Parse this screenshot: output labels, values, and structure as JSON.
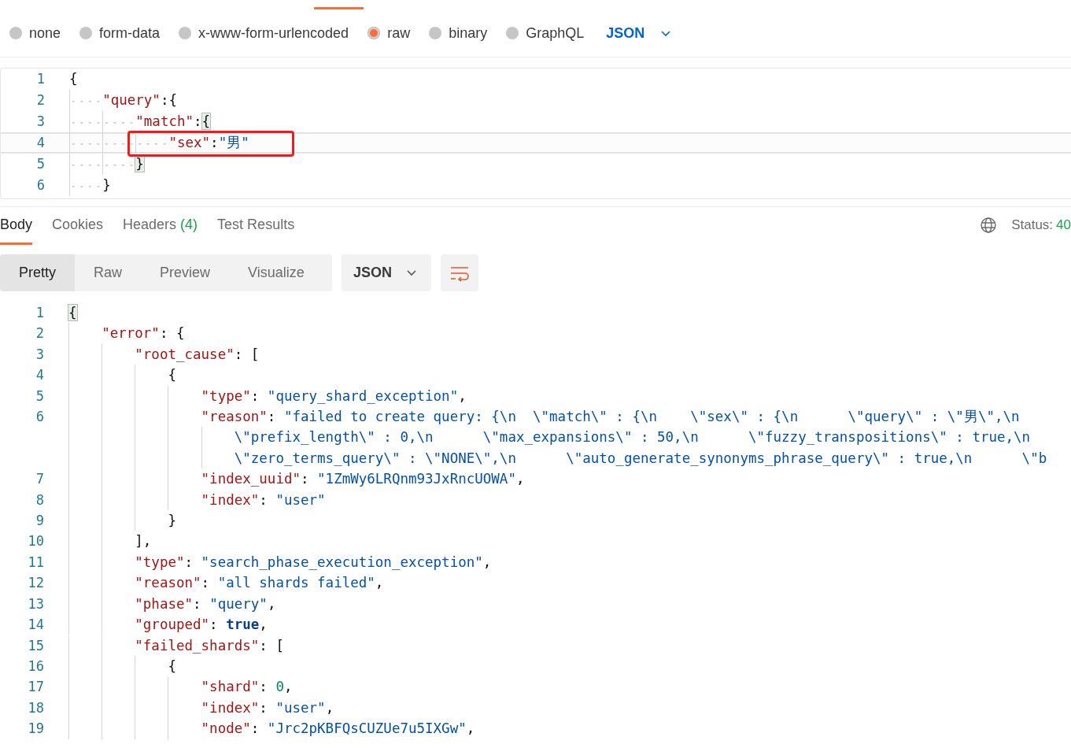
{
  "body_types": [
    {
      "label": "none",
      "selected": false
    },
    {
      "label": "form-data",
      "selected": false
    },
    {
      "label": "x-www-form-urlencoded",
      "selected": false
    },
    {
      "label": "raw",
      "selected": true
    },
    {
      "label": "binary",
      "selected": false
    },
    {
      "label": "GraphQL",
      "selected": false
    }
  ],
  "body_format": "JSON",
  "request_editor": {
    "show_whitespace": true,
    "lines": [
      {
        "number": "1",
        "active": false,
        "kind": "level0",
        "tokens": [
          {
            "t": "{",
            "kind": "punc"
          }
        ]
      },
      {
        "number": "2",
        "active": false,
        "kind": "level1",
        "tokens": [
          {
            "t": "\"query\"",
            "kind": "key"
          },
          {
            "t": ":",
            "kind": "punc"
          },
          {
            "t": "{",
            "kind": "punc"
          }
        ]
      },
      {
        "number": "3",
        "active": false,
        "kind": "level2",
        "tokens": [
          {
            "t": "\"match\"",
            "kind": "key"
          },
          {
            "t": ":",
            "kind": "punc"
          },
          {
            "t": "{",
            "kind": "brace-match"
          }
        ]
      },
      {
        "number": "4",
        "active": true,
        "kind": "level3",
        "tokens": [
          {
            "t": "\"sex\"",
            "kind": "key"
          },
          {
            "t": ":",
            "kind": "punc"
          },
          {
            "t": "\"男\"",
            "kind": "str"
          }
        ]
      },
      {
        "number": "5",
        "active": false,
        "kind": "level2",
        "tokens": [
          {
            "t": "}",
            "kind": "brace-match"
          }
        ]
      },
      {
        "number": "6",
        "active": false,
        "kind": "level1",
        "tokens": [
          {
            "t": "}",
            "kind": "punc"
          }
        ]
      }
    ]
  },
  "annotation": {
    "kind": "box"
  },
  "response": {
    "tabs": [
      {
        "label": "Body",
        "selected": true
      },
      {
        "label": "Cookies",
        "selected": false
      },
      {
        "label": "Headers",
        "count": "(4)",
        "selected": false
      },
      {
        "label": "Test Results",
        "selected": false
      }
    ],
    "status": {
      "label": "Status:",
      "value": "40"
    },
    "view_modes": [
      {
        "label": "Pretty",
        "selected": true
      },
      {
        "label": "Raw",
        "selected": false
      },
      {
        "label": "Preview",
        "selected": false
      },
      {
        "label": "Visualize",
        "selected": false
      }
    ],
    "format": "JSON",
    "editor": {
      "show_whitespace": false,
      "lines": [
        {
          "number": "1",
          "rows": [
            {
              "kind": "level0",
              "tokens": [
                {
                  "t": "{",
                  "kind": "brace-match"
                }
              ]
            }
          ]
        },
        {
          "number": "2",
          "rows": [
            {
              "kind": "level1",
              "tokens": [
                {
                  "t": "\"error\"",
                  "kind": "key"
                },
                {
                  "t": ": {",
                  "kind": "punc"
                }
              ]
            }
          ]
        },
        {
          "number": "3",
          "rows": [
            {
              "kind": "level2",
              "tokens": [
                {
                  "t": "\"root_cause\"",
                  "kind": "key"
                },
                {
                  "t": ": [",
                  "kind": "punc"
                }
              ]
            }
          ]
        },
        {
          "number": "4",
          "rows": [
            {
              "kind": "level3",
              "tokens": [
                {
                  "t": "{",
                  "kind": "punc"
                }
              ]
            }
          ]
        },
        {
          "number": "5",
          "rows": [
            {
              "kind": "level4",
              "tokens": [
                {
                  "t": "\"type\"",
                  "kind": "key"
                },
                {
                  "t": ": ",
                  "kind": "punc"
                },
                {
                  "t": "\"query_shard_exception\"",
                  "kind": "str"
                },
                {
                  "t": ",",
                  "kind": "punc"
                }
              ]
            }
          ]
        },
        {
          "number": "6",
          "rows": [
            {
              "kind": "level4",
              "tokens": [
                {
                  "t": "\"reason\"",
                  "kind": "key"
                },
                {
                  "t": ": ",
                  "kind": "punc"
                },
                {
                  "t": "\"failed to create query: {\\n  \\\"match\\\" : {\\n    \\\"sex\\\" : {\\n      \\\"query\\\" : \\\"男\\\",\\n",
                  "kind": "str"
                }
              ]
            },
            {
              "kind": "wrap",
              "tokens": [
                {
                  "t": "\\\"prefix_length\\\" : 0,\\n      \\\"max_expansions\\\" : 50,\\n      \\\"fuzzy_transpositions\\\" : true,\\n",
                  "kind": "str"
                }
              ]
            },
            {
              "kind": "wrap",
              "tokens": [
                {
                  "t": "\\\"zero_terms_query\\\" : \\\"NONE\\\",\\n      \\\"auto_generate_synonyms_phrase_query\\\" : true,\\n      \\\"b",
                  "kind": "str"
                }
              ]
            }
          ]
        },
        {
          "number": "7",
          "rows": [
            {
              "kind": "level4",
              "tokens": [
                {
                  "t": "\"index_uuid\"",
                  "kind": "key"
                },
                {
                  "t": ": ",
                  "kind": "punc"
                },
                {
                  "t": "\"1ZmWy6LRQnm93JxRncUOWA\"",
                  "kind": "str"
                },
                {
                  "t": ",",
                  "kind": "punc"
                }
              ]
            }
          ]
        },
        {
          "number": "8",
          "rows": [
            {
              "kind": "level4",
              "tokens": [
                {
                  "t": "\"index\"",
                  "kind": "key"
                },
                {
                  "t": ": ",
                  "kind": "punc"
                },
                {
                  "t": "\"user\"",
                  "kind": "str"
                }
              ]
            }
          ]
        },
        {
          "number": "9",
          "rows": [
            {
              "kind": "level3",
              "tokens": [
                {
                  "t": "}",
                  "kind": "punc"
                }
              ]
            }
          ]
        },
        {
          "number": "10",
          "rows": [
            {
              "kind": "level2",
              "tokens": [
                {
                  "t": "],",
                  "kind": "punc"
                }
              ]
            }
          ]
        },
        {
          "number": "11",
          "rows": [
            {
              "kind": "level2",
              "tokens": [
                {
                  "t": "\"type\"",
                  "kind": "key"
                },
                {
                  "t": ": ",
                  "kind": "punc"
                },
                {
                  "t": "\"search_phase_execution_exception\"",
                  "kind": "str"
                },
                {
                  "t": ",",
                  "kind": "punc"
                }
              ]
            }
          ]
        },
        {
          "number": "12",
          "rows": [
            {
              "kind": "level2",
              "tokens": [
                {
                  "t": "\"reason\"",
                  "kind": "key"
                },
                {
                  "t": ": ",
                  "kind": "punc"
                },
                {
                  "t": "\"all shards failed\"",
                  "kind": "str"
                },
                {
                  "t": ",",
                  "kind": "punc"
                }
              ]
            }
          ]
        },
        {
          "number": "13",
          "rows": [
            {
              "kind": "level2",
              "tokens": [
                {
                  "t": "\"phase\"",
                  "kind": "key"
                },
                {
                  "t": ": ",
                  "kind": "punc"
                },
                {
                  "t": "\"query\"",
                  "kind": "str"
                },
                {
                  "t": ",",
                  "kind": "punc"
                }
              ]
            }
          ]
        },
        {
          "number": "14",
          "rows": [
            {
              "kind": "level2",
              "tokens": [
                {
                  "t": "\"grouped\"",
                  "kind": "key"
                },
                {
                  "t": ": ",
                  "kind": "punc"
                },
                {
                  "t": "true",
                  "kind": "bool"
                },
                {
                  "t": ",",
                  "kind": "punc"
                }
              ]
            }
          ]
        },
        {
          "number": "15",
          "rows": [
            {
              "kind": "level2",
              "tokens": [
                {
                  "t": "\"failed_shards\"",
                  "kind": "key"
                },
                {
                  "t": ": [",
                  "kind": "punc"
                }
              ]
            }
          ]
        },
        {
          "number": "16",
          "rows": [
            {
              "kind": "level3",
              "tokens": [
                {
                  "t": "{",
                  "kind": "punc"
                }
              ]
            }
          ]
        },
        {
          "number": "17",
          "rows": [
            {
              "kind": "level4",
              "tokens": [
                {
                  "t": "\"shard\"",
                  "kind": "key"
                },
                {
                  "t": ": ",
                  "kind": "punc"
                },
                {
                  "t": "0",
                  "kind": "num"
                },
                {
                  "t": ",",
                  "kind": "punc"
                }
              ]
            }
          ]
        },
        {
          "number": "18",
          "rows": [
            {
              "kind": "level4",
              "tokens": [
                {
                  "t": "\"index\"",
                  "kind": "key"
                },
                {
                  "t": ": ",
                  "kind": "punc"
                },
                {
                  "t": "\"user\"",
                  "kind": "str"
                },
                {
                  "t": ",",
                  "kind": "punc"
                }
              ]
            }
          ]
        },
        {
          "number": "19",
          "rows": [
            {
              "kind": "level4",
              "tokens": [
                {
                  "t": "\"node\"",
                  "kind": "key"
                },
                {
                  "t": ": ",
                  "kind": "punc"
                },
                {
                  "t": "\"Jrc2pKBFQsCUZUe7u5IXGw\"",
                  "kind": "str"
                },
                {
                  "t": ",",
                  "kind": "punc"
                }
              ]
            }
          ]
        }
      ]
    }
  }
}
